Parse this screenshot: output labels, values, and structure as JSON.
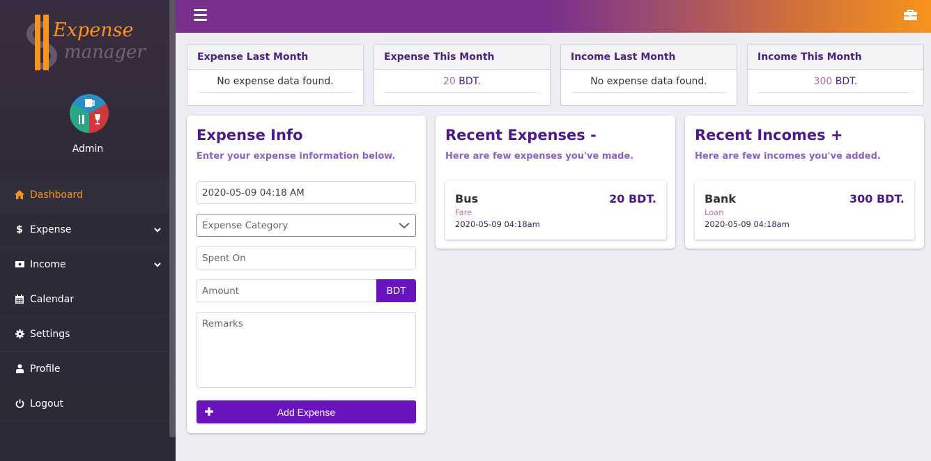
{
  "sidebar": {
    "logo": {
      "line1": "Expense",
      "line2": "manager"
    },
    "user": {
      "name": "Admin"
    },
    "items": [
      {
        "label": "Dashboard",
        "icon": "home-icon",
        "active": true
      },
      {
        "label": "Expense",
        "icon": "dollar-icon",
        "has_submenu": true
      },
      {
        "label": "Income",
        "icon": "money-bill-icon",
        "has_submenu": true
      },
      {
        "label": "Calendar",
        "icon": "calendar-icon"
      },
      {
        "label": "Settings",
        "icon": "gear-icon"
      },
      {
        "label": "Profile",
        "icon": "user-icon"
      },
      {
        "label": "Logout",
        "icon": "power-icon"
      }
    ]
  },
  "topbar": {
    "menu_icon": "hamburger-icon",
    "right_icon": "toolbox-icon"
  },
  "stats": [
    {
      "title": "Expense Last Month",
      "empty_text": "No expense data found."
    },
    {
      "title": "Expense This Month",
      "value": "20",
      "unit": "BDT."
    },
    {
      "title": "Income Last Month",
      "empty_text": "No expense data found."
    },
    {
      "title": "Income This Month",
      "value": "300",
      "unit": "BDT."
    }
  ],
  "expense_form": {
    "title": "Expense Info",
    "subtitle": "Enter your expense information below.",
    "datetime_value": "2020-05-09 04:18 AM",
    "category_placeholder": "Expense Category",
    "spent_on_placeholder": "Spent On",
    "amount_placeholder": "Amount",
    "currency": "BDT",
    "remarks_placeholder": "Remarks",
    "submit_label": "Add Expense"
  },
  "recent_expenses": {
    "title": "Recent Expenses -",
    "subtitle": "Here are few expenses you've made.",
    "items": [
      {
        "name": "Bus",
        "amount": "20 BDT.",
        "category": "Fare",
        "date": "2020-05-09 04:18am"
      }
    ]
  },
  "recent_incomes": {
    "title": "Recent Incomes +",
    "subtitle": "Here are few incomes you've added.",
    "items": [
      {
        "name": "Bank",
        "amount": "300 BDT.",
        "category": "Loan",
        "date": "2020-05-09 04:18am"
      }
    ]
  },
  "colors": {
    "primary": "#6a14be",
    "heading": "#4a1a8c",
    "accent": "#f7941d",
    "topbar_start": "#7a318d",
    "topbar_end": "#f7941d",
    "sidebar_bg": "#2a2b36"
  }
}
